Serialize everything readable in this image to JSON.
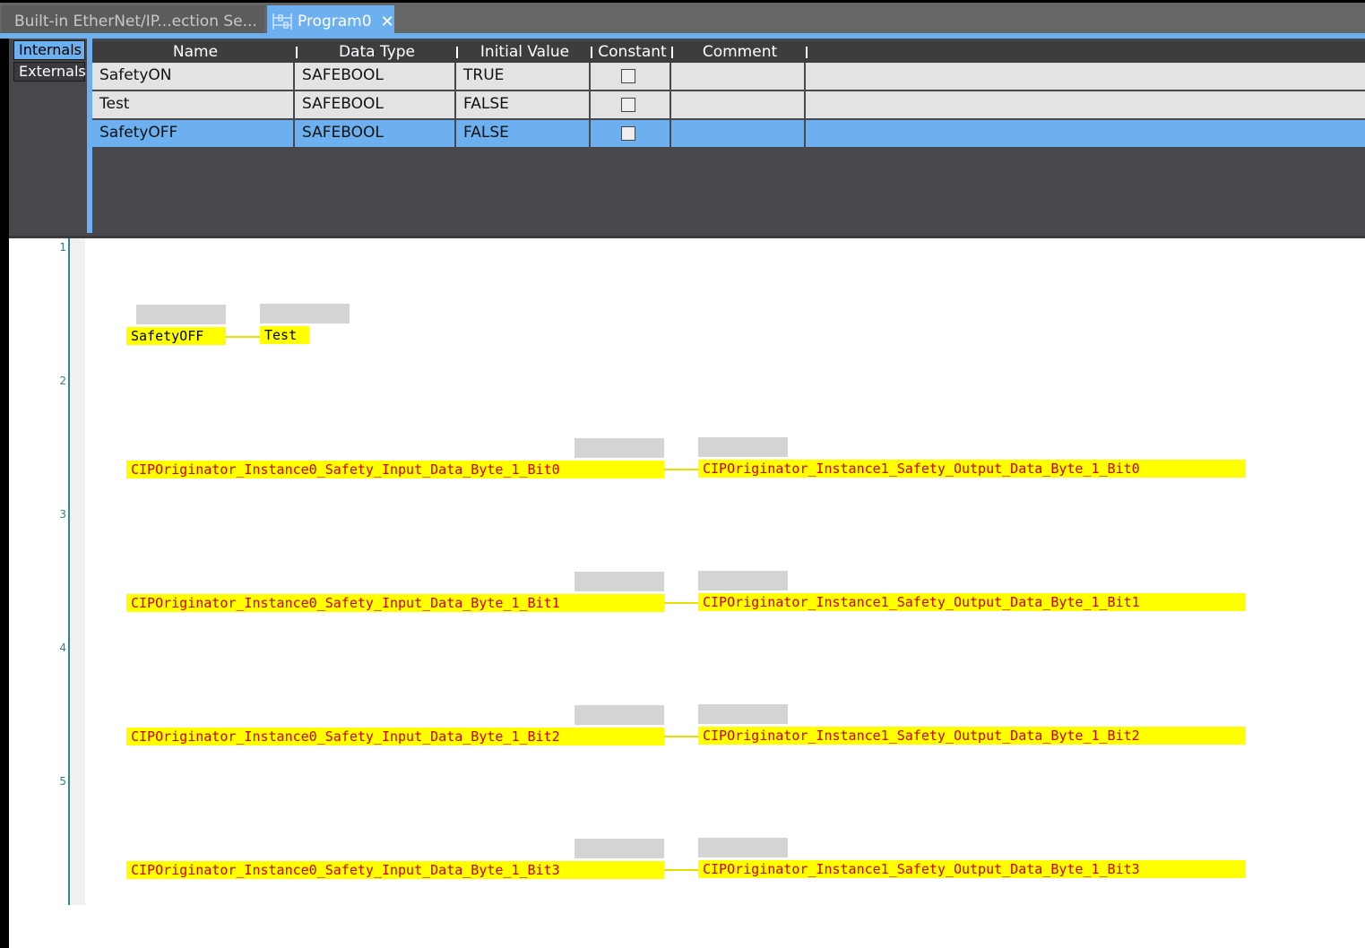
{
  "tabs": [
    {
      "label": "Built-in EtherNet/IP...ection Se..."
    },
    {
      "label": "Program0",
      "close": "✕"
    }
  ],
  "variable_tabs": {
    "internals": "Internals",
    "externals": "Externals"
  },
  "table": {
    "headers": [
      "Name",
      "Data Type",
      "Initial Value",
      "Constant",
      "Comment"
    ],
    "rows": [
      {
        "name": "SafetyON",
        "type": "SAFEBOOL",
        "initial": "TRUE",
        "constant": false,
        "comment": ""
      },
      {
        "name": "Test",
        "type": "SAFEBOOL",
        "initial": "FALSE",
        "constant": false,
        "comment": ""
      },
      {
        "name": "SafetyOFF",
        "type": "SAFEBOOL",
        "initial": "FALSE",
        "constant": false,
        "comment": "",
        "selected": true
      }
    ]
  },
  "rungs": [
    {
      "number": "1",
      "input": "SafetyOFF",
      "output": "Test"
    },
    {
      "number": "2",
      "input": "CIPOriginator_Instance0_Safety_Input_Data_Byte_1_Bit0",
      "output": "CIPOriginator_Instance1_Safety_Output_Data_Byte_1_Bit0"
    },
    {
      "number": "3",
      "input": "CIPOriginator_Instance0_Safety_Input_Data_Byte_1_Bit1",
      "output": "CIPOriginator_Instance1_Safety_Output_Data_Byte_1_Bit1"
    },
    {
      "number": "4",
      "input": "CIPOriginator_Instance0_Safety_Input_Data_Byte_1_Bit2",
      "output": "CIPOriginator_Instance1_Safety_Output_Data_Byte_1_Bit2"
    },
    {
      "number": "5",
      "input": "CIPOriginator_Instance0_Safety_Input_Data_Byte_1_Bit3",
      "output": "CIPOriginator_Instance1_Safety_Output_Data_Byte_1_Bit3"
    }
  ],
  "colors": {
    "accent": "#6cb0ef",
    "variable_highlight": "#ffff00",
    "variable_text": "#cc0000"
  }
}
